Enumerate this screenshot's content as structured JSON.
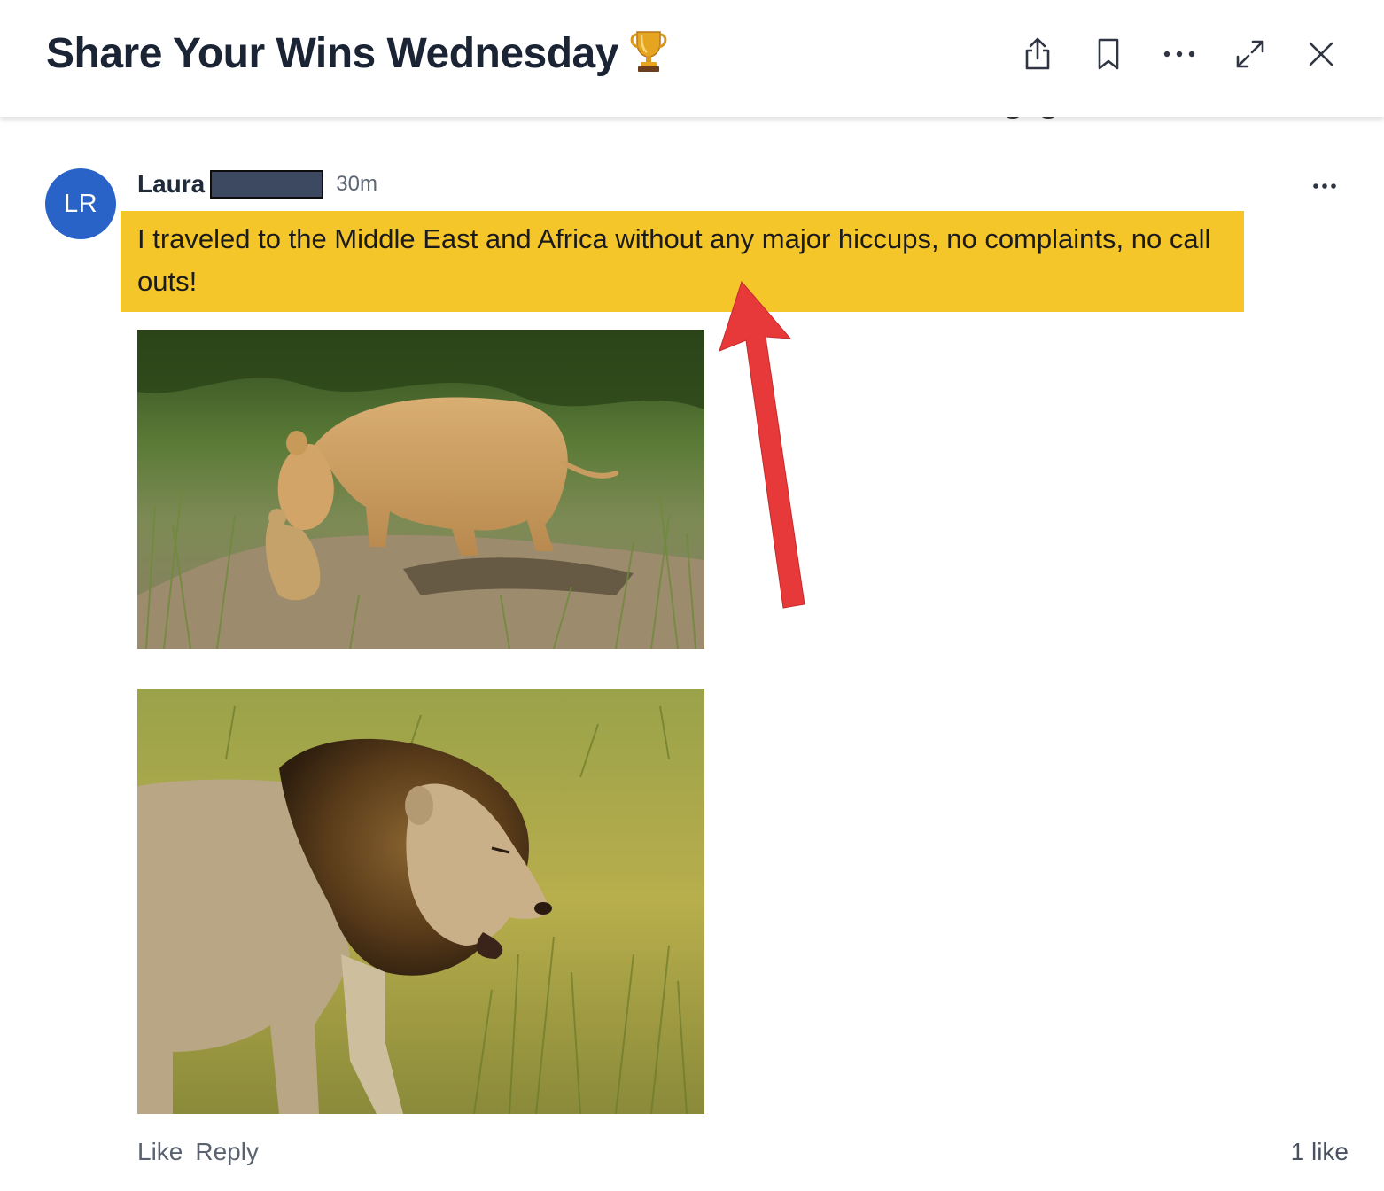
{
  "header": {
    "title": "Share Your Wins Wednesday",
    "title_emoji": "trophy-icon",
    "actions": [
      "share-icon",
      "bookmark-icon",
      "more-horizontal-icon",
      "expand-icon",
      "close-icon"
    ]
  },
  "post": {
    "avatar_initials": "LR",
    "avatar_color": "#2a63c8",
    "author": "Laura",
    "time": "30m",
    "text": "I traveled to the Middle East and Africa without any major hiccups, no complaints, no call outs!",
    "highlight_color": "#f5c62a",
    "annotation_arrow_color": "#e8393a",
    "images": [
      "lioness carrying cub photo",
      "male lion photo"
    ],
    "actions": {
      "like": "Like",
      "reply": "Reply"
    },
    "likes": "1 like"
  }
}
